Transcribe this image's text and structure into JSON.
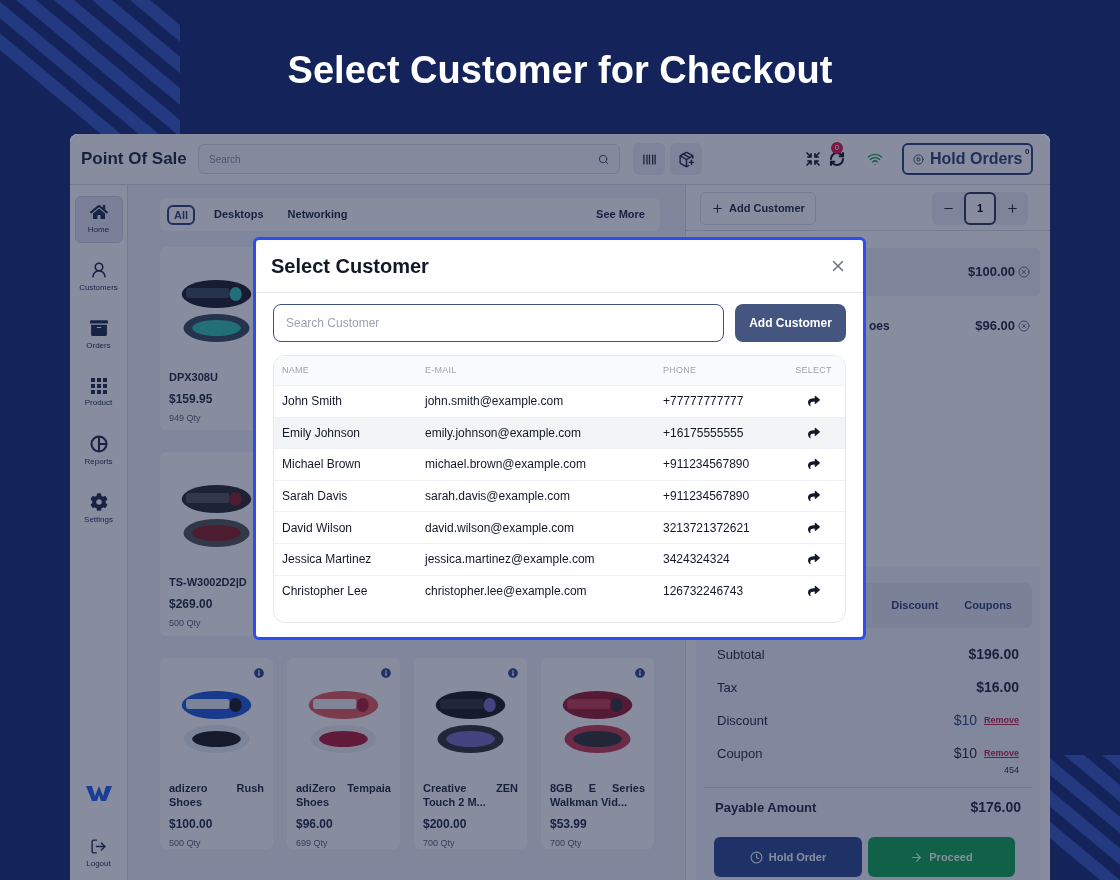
{
  "headline": "Select Customer for Checkout",
  "app": {
    "title": "Point Of Sale",
    "search": {
      "placeholder": "Search"
    },
    "hold_orders": {
      "label": "Hold Orders",
      "count": "0"
    },
    "sync_badge": "0"
  },
  "sidebar": {
    "items": [
      {
        "label": "Home",
        "selected": true
      },
      {
        "label": "Customers",
        "selected": false
      },
      {
        "label": "Orders",
        "selected": false
      },
      {
        "label": "Product",
        "selected": false
      },
      {
        "label": "Reports",
        "selected": false
      },
      {
        "label": "Settings",
        "selected": false
      }
    ],
    "logout": "Logout"
  },
  "categories": {
    "items": [
      {
        "label": "All",
        "selected": true
      },
      {
        "label": "Desktops",
        "selected": false
      },
      {
        "label": "Networking",
        "selected": false
      }
    ],
    "more": "See More"
  },
  "products": [
    {
      "name": "DPX308U",
      "price": "$159.95",
      "qty": "949 Qty"
    },
    {
      "name": "TS-W3002D2|D",
      "price": "$269.00",
      "qty": "500 Qty"
    },
    {
      "name": "adizero Rush Shoes",
      "price": "$100.00",
      "qty": "500 Qty"
    },
    {
      "name": "adiZero Tempaia Shoes",
      "price": "$96.00",
      "qty": "699 Qty"
    },
    {
      "name": "Creative ZEN Touch 2 M...",
      "price": "$200.00",
      "qty": "700 Qty"
    },
    {
      "name": "8GB E Series Walkman Vid...",
      "price": "$53.99",
      "qty": "700 Qty"
    }
  ],
  "cart": {
    "add_customer": "Add Customer",
    "quantity": "1",
    "items": [
      {
        "price": "$100.00"
      },
      {
        "name": "oes",
        "price": "$96.00"
      }
    ],
    "tabs": [
      {
        "label": "Discount"
      },
      {
        "label": "Coupons"
      }
    ],
    "summary": [
      {
        "label": "Subtotal",
        "value": "$196.00",
        "kind": "plain"
      },
      {
        "label": "Tax",
        "value": "$16.00",
        "kind": "plain"
      },
      {
        "label": "Discount",
        "value": "$10",
        "action": "Remove",
        "kind": "discount"
      },
      {
        "label": "Coupon",
        "value": "$10",
        "action": "Remove",
        "kind": "coupon",
        "note": "454"
      }
    ],
    "payable": {
      "label": "Payable Amount",
      "value": "$176.00"
    },
    "buttons": {
      "hold": "Hold Order",
      "proceed": "Proceed"
    }
  },
  "modal": {
    "title": "Select Customer",
    "search": {
      "placeholder": "Search Customer"
    },
    "add_button": "Add Customer",
    "columns": [
      "NAME",
      "E-MAIL",
      "PHONE",
      "SELECT"
    ],
    "rows": [
      {
        "name": "John Smith",
        "email": "john.smith@example.com",
        "phone": "+77777777777",
        "highlighted": false
      },
      {
        "name": "Emily Johnson",
        "email": "emily.johnson@example.com",
        "phone": "+16175555555",
        "highlighted": true
      },
      {
        "name": "Michael Brown",
        "email": "michael.brown@example.com",
        "phone": "+911234567890",
        "highlighted": false
      },
      {
        "name": "Sarah Davis",
        "email": "sarah.davis@example.com",
        "phone": "+911234567890",
        "highlighted": false
      },
      {
        "name": "David Wilson",
        "email": "david.wilson@example.com",
        "phone": "3213721372621",
        "highlighted": false
      },
      {
        "name": "Jessica Martinez",
        "email": "jessica.martinez@example.com",
        "phone": "3424324324",
        "highlighted": false
      },
      {
        "name": "Christopher Lee",
        "email": "christopher.lee@example.com",
        "phone": "126732246743",
        "highlighted": false
      }
    ]
  }
}
